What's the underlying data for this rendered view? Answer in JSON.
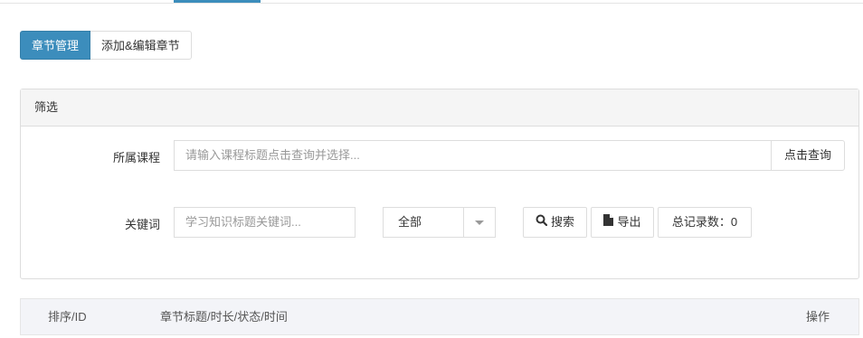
{
  "tabs": [
    {
      "label": "章节管理",
      "active": true
    },
    {
      "label": "添加&编辑章节",
      "active": false
    }
  ],
  "filter": {
    "title": "筛选",
    "course": {
      "label": "所属课程",
      "placeholder": "请输入课程标题点击查询并选择...",
      "query_button": "点击查询"
    },
    "keyword": {
      "label": "关键词",
      "placeholder": "学习知识标题关键词..."
    },
    "status_select": {
      "selected": "全部"
    },
    "search_button": "搜索",
    "export_button": "导出",
    "total_label": "总记录数：0"
  },
  "table": {
    "headers": [
      "排序/ID",
      "章节标题/时长/状态/时间",
      "操作"
    ]
  },
  "colors": {
    "accent": "#3c8dbc",
    "panel_head_bg": "#f5f5f5",
    "table_head_bg": "#f3f4f8"
  },
  "icons": {
    "search": "search-icon",
    "export": "file-icon",
    "dropdown": "chevron-down-icon"
  }
}
